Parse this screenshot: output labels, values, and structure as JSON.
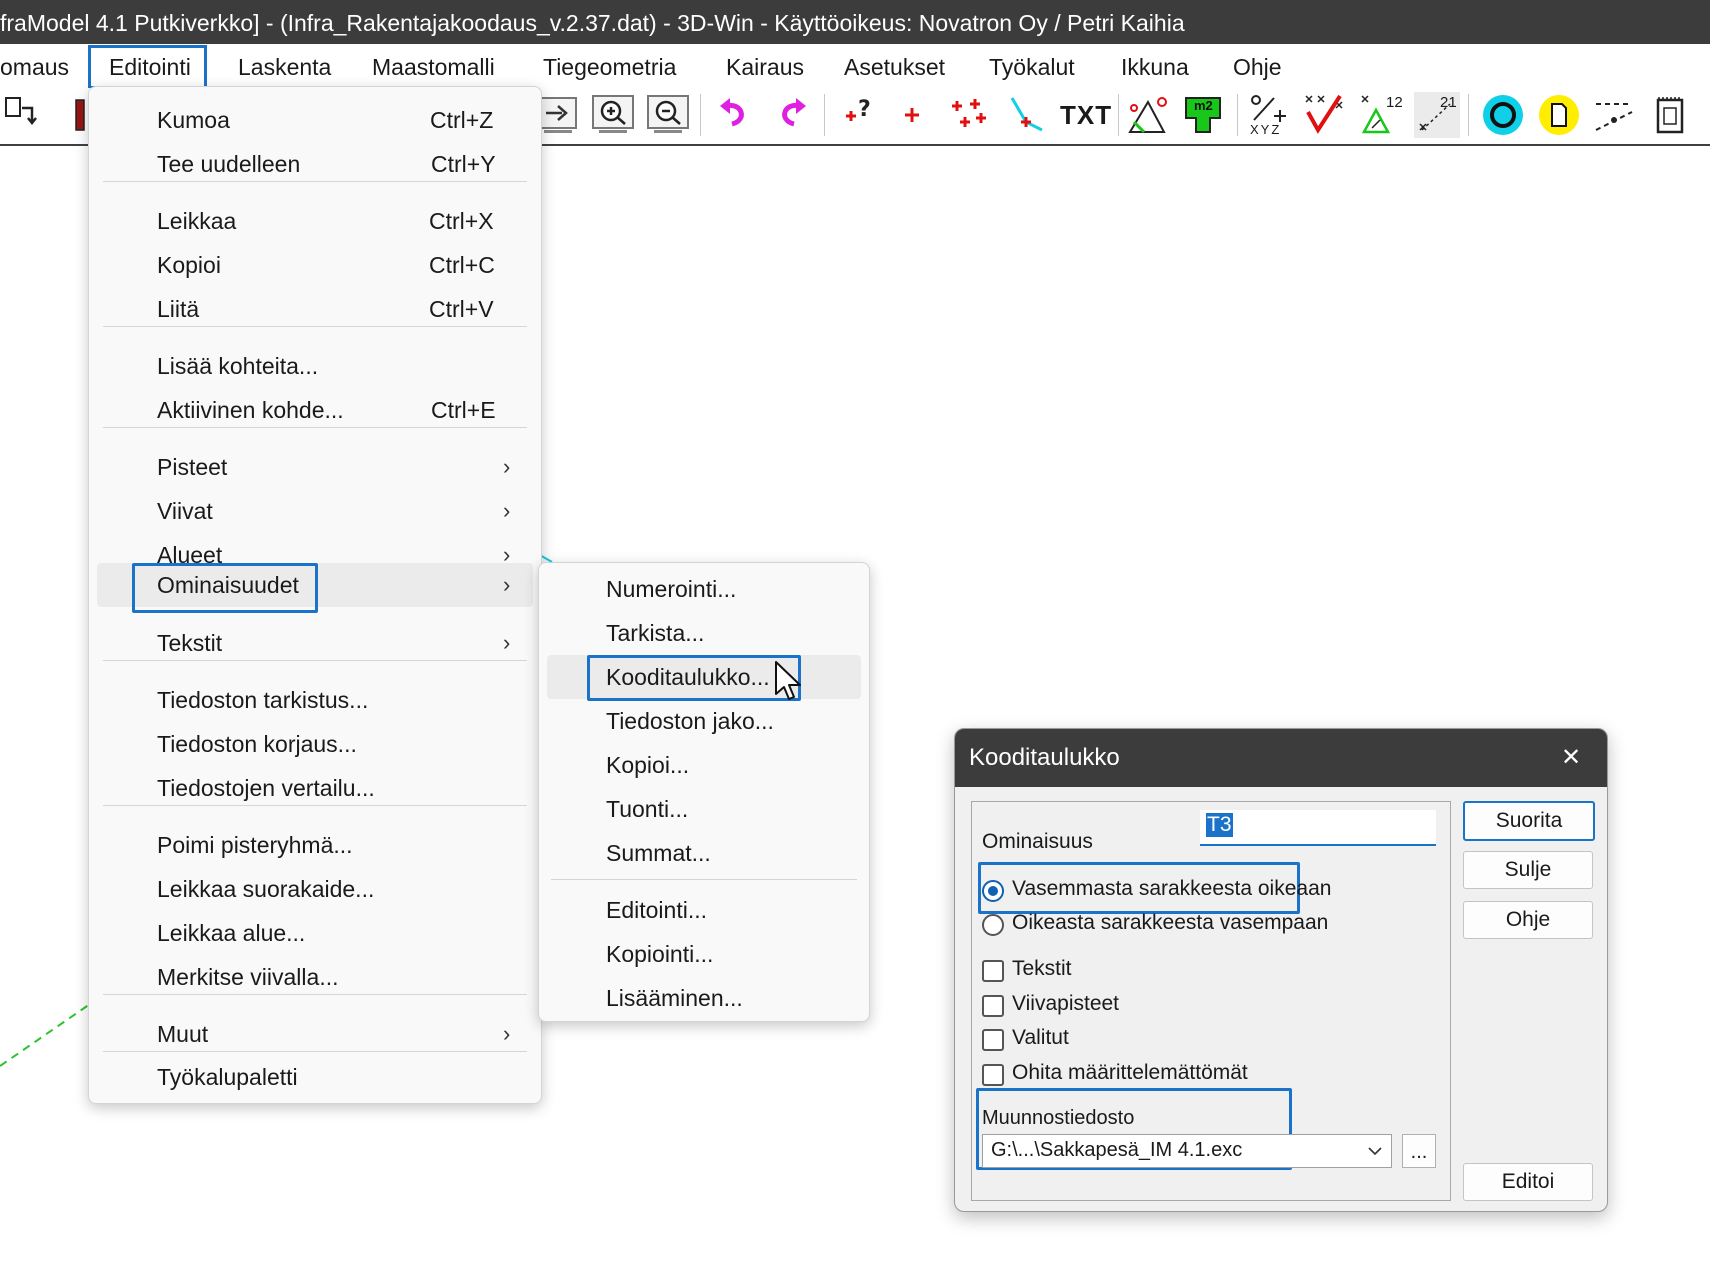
{
  "titlebar": {
    "text": "fraModel 4.1 Putkiverkko] - (Infra_Rakentajakoodaus_v.2.37.dat) - 3D-Win - Käyttöoikeus: Novatron Oy / Petri Kaihia"
  },
  "menubar": {
    "items": [
      "omaus",
      "Editointi",
      "Laskenta",
      "Maastomalli",
      "Tiegeometria",
      "Kairaus",
      "Asetukset",
      "Työkalut",
      "Ikkuna",
      "Ohje"
    ],
    "active": "Editointi"
  },
  "toolbar": {
    "icons": [
      "open-arrow-icon",
      "red-book-icon",
      "arrow-right-icon",
      "zoom-in-icon",
      "zoom-out-icon",
      "undo-icon",
      "redo-icon",
      "point-query-icon",
      "add-point-icon",
      "multi-point-icon",
      "line-point-icon",
      "txt-icon",
      "triangle-measure-icon",
      "area-m2-icon",
      "percent-xyz-icon",
      "check-points-icon",
      "triangle-numbered-icon",
      "numbered-points-icon",
      "circle-cyan-icon",
      "yellow-page-icon",
      "dashed-line-icon",
      "document-icon"
    ],
    "txt_label": "TXT",
    "m2_label": "m2",
    "xyz_label": "XYZ",
    "num12_label": "12",
    "num21_label": "21",
    "colors": {
      "magenta": "#e020e0",
      "red": "#e01010",
      "cyan": "#10d0e8",
      "yellow": "#ffee00",
      "green": "#18c818"
    }
  },
  "editointi_menu": {
    "items": [
      {
        "label": "Kumoa",
        "shortcut": "Ctrl+Z"
      },
      {
        "label": "Tee uudelleen",
        "shortcut": "Ctrl+Y"
      },
      {
        "label": "Leikkaa",
        "shortcut": "Ctrl+X"
      },
      {
        "label": "Kopioi",
        "shortcut": "Ctrl+C"
      },
      {
        "label": "Liitä",
        "shortcut": "Ctrl+V"
      },
      {
        "label": "Lisää kohteita...",
        "shortcut": ""
      },
      {
        "label": "Aktiivinen kohde...",
        "shortcut": "Ctrl+E"
      },
      {
        "label": "Pisteet",
        "shortcut": ""
      },
      {
        "label": "Viivat",
        "shortcut": ""
      },
      {
        "label": "Alueet",
        "shortcut": ""
      },
      {
        "label": "Ominaisuudet",
        "shortcut": ""
      },
      {
        "label": "Tekstit",
        "shortcut": ""
      },
      {
        "label": "Tiedoston tarkistus...",
        "shortcut": ""
      },
      {
        "label": "Tiedoston korjaus...",
        "shortcut": ""
      },
      {
        "label": "Tiedostojen vertailu...",
        "shortcut": ""
      },
      {
        "label": "Poimi pisteryhmä...",
        "shortcut": ""
      },
      {
        "label": "Leikkaa suorakaide...",
        "shortcut": ""
      },
      {
        "label": "Leikkaa alue...",
        "shortcut": ""
      },
      {
        "label": "Merkitse viivalla...",
        "shortcut": ""
      },
      {
        "label": "Muut",
        "shortcut": ""
      },
      {
        "label": "Työkalupaletti",
        "shortcut": ""
      }
    ],
    "submenu_arrow": "›"
  },
  "ominaisuudet_submenu": {
    "items": [
      {
        "label": "Numerointi..."
      },
      {
        "label": "Tarkista..."
      },
      {
        "label": "Kooditaulukko..."
      },
      {
        "label": "Tiedoston jako..."
      },
      {
        "label": "Kopioi..."
      },
      {
        "label": "Tuonti..."
      },
      {
        "label": "Summat..."
      },
      {
        "label": "Editointi..."
      },
      {
        "label": "Kopiointi..."
      },
      {
        "label": "Lisääminen..."
      }
    ],
    "hovered": "Kooditaulukko..."
  },
  "dialog": {
    "title": "Kooditaulukko",
    "close_glyph": "✕",
    "ominaisuus_label": "Ominaisuus",
    "ominaisuus_value": "T3",
    "radio_options": [
      {
        "label": "Vasemmasta sarakkeesta oikeaan",
        "checked": true
      },
      {
        "label": "Oikeasta sarakkeesta vasempaan",
        "checked": false
      }
    ],
    "checkboxes": [
      {
        "label": "Tekstit",
        "checked": false
      },
      {
        "label": "Viivapisteet",
        "checked": false
      },
      {
        "label": "Valitut",
        "checked": false
      },
      {
        "label": "Ohita määrittelemättömät",
        "checked": false
      }
    ],
    "muunnostiedosto_label": "Muunnostiedosto",
    "muunnostiedosto_value": "G:\\...\\Sakkapesä_IM 4.1.exc",
    "browse_label": "...",
    "buttons": {
      "suorita": "Suorita",
      "sulje": "Sulje",
      "ohje": "Ohje",
      "editoi": "Editoi"
    }
  }
}
